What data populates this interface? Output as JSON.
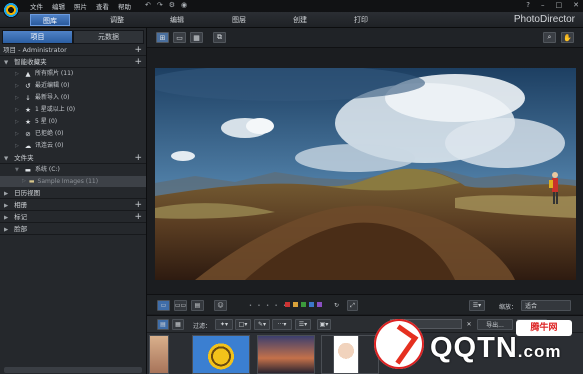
{
  "titlebar": {
    "menu": [
      "文件",
      "编辑",
      "照片",
      "查看",
      "帮助"
    ],
    "tool_icons": [
      "↶",
      "↷",
      "⚙",
      "◉"
    ],
    "help": "?",
    "minimize": "–",
    "restore": "□",
    "close": "✕"
  },
  "modes": {
    "library": "图库",
    "adjust": "调整",
    "edit": "编辑",
    "layers": "图层",
    "create": "创建",
    "print": "打印"
  },
  "brand": "PhotoDirector",
  "left_panel": {
    "tab_project": "项目",
    "tab_metadata": "元数据",
    "project_header": "项目 - Administrator",
    "smart_collections": {
      "label": "智能收藏夹",
      "items": [
        {
          "label": "所有照片 (11)",
          "icon": "▲"
        },
        {
          "label": "最近编辑 (0)",
          "icon": "↺"
        },
        {
          "label": "最新导入 (0)",
          "icon": "↓"
        },
        {
          "label": "1 星或以上 (0)",
          "icon": "★"
        },
        {
          "label": "5 星 (0)",
          "icon": "★"
        },
        {
          "label": "已拒绝 (0)",
          "icon": "⊘"
        },
        {
          "label": "讯连云 (0)",
          "icon": "☁"
        }
      ]
    },
    "folders": {
      "label": "文件夹",
      "drive": "系统 (C:)",
      "folder": "Sample Images (11)"
    },
    "calendar": "日历视图",
    "albums": "相册",
    "tags": "标记",
    "faces": "脸部"
  },
  "strip": {
    "filter_label": "过滤：",
    "rating_label": "缩放：",
    "rating_value": "适合",
    "export_label": "导出...",
    "share_label": "共享"
  },
  "colors": {
    "accent": "#2f63a8",
    "panel": "#25282c",
    "swatches": [
      "#c33",
      "#d9a23a",
      "#3c9a3c",
      "#3b78c8",
      "#8a4fc2"
    ]
  },
  "watermark": {
    "text": "QQTN",
    "suffix": ".com",
    "badge": "腾牛网"
  }
}
